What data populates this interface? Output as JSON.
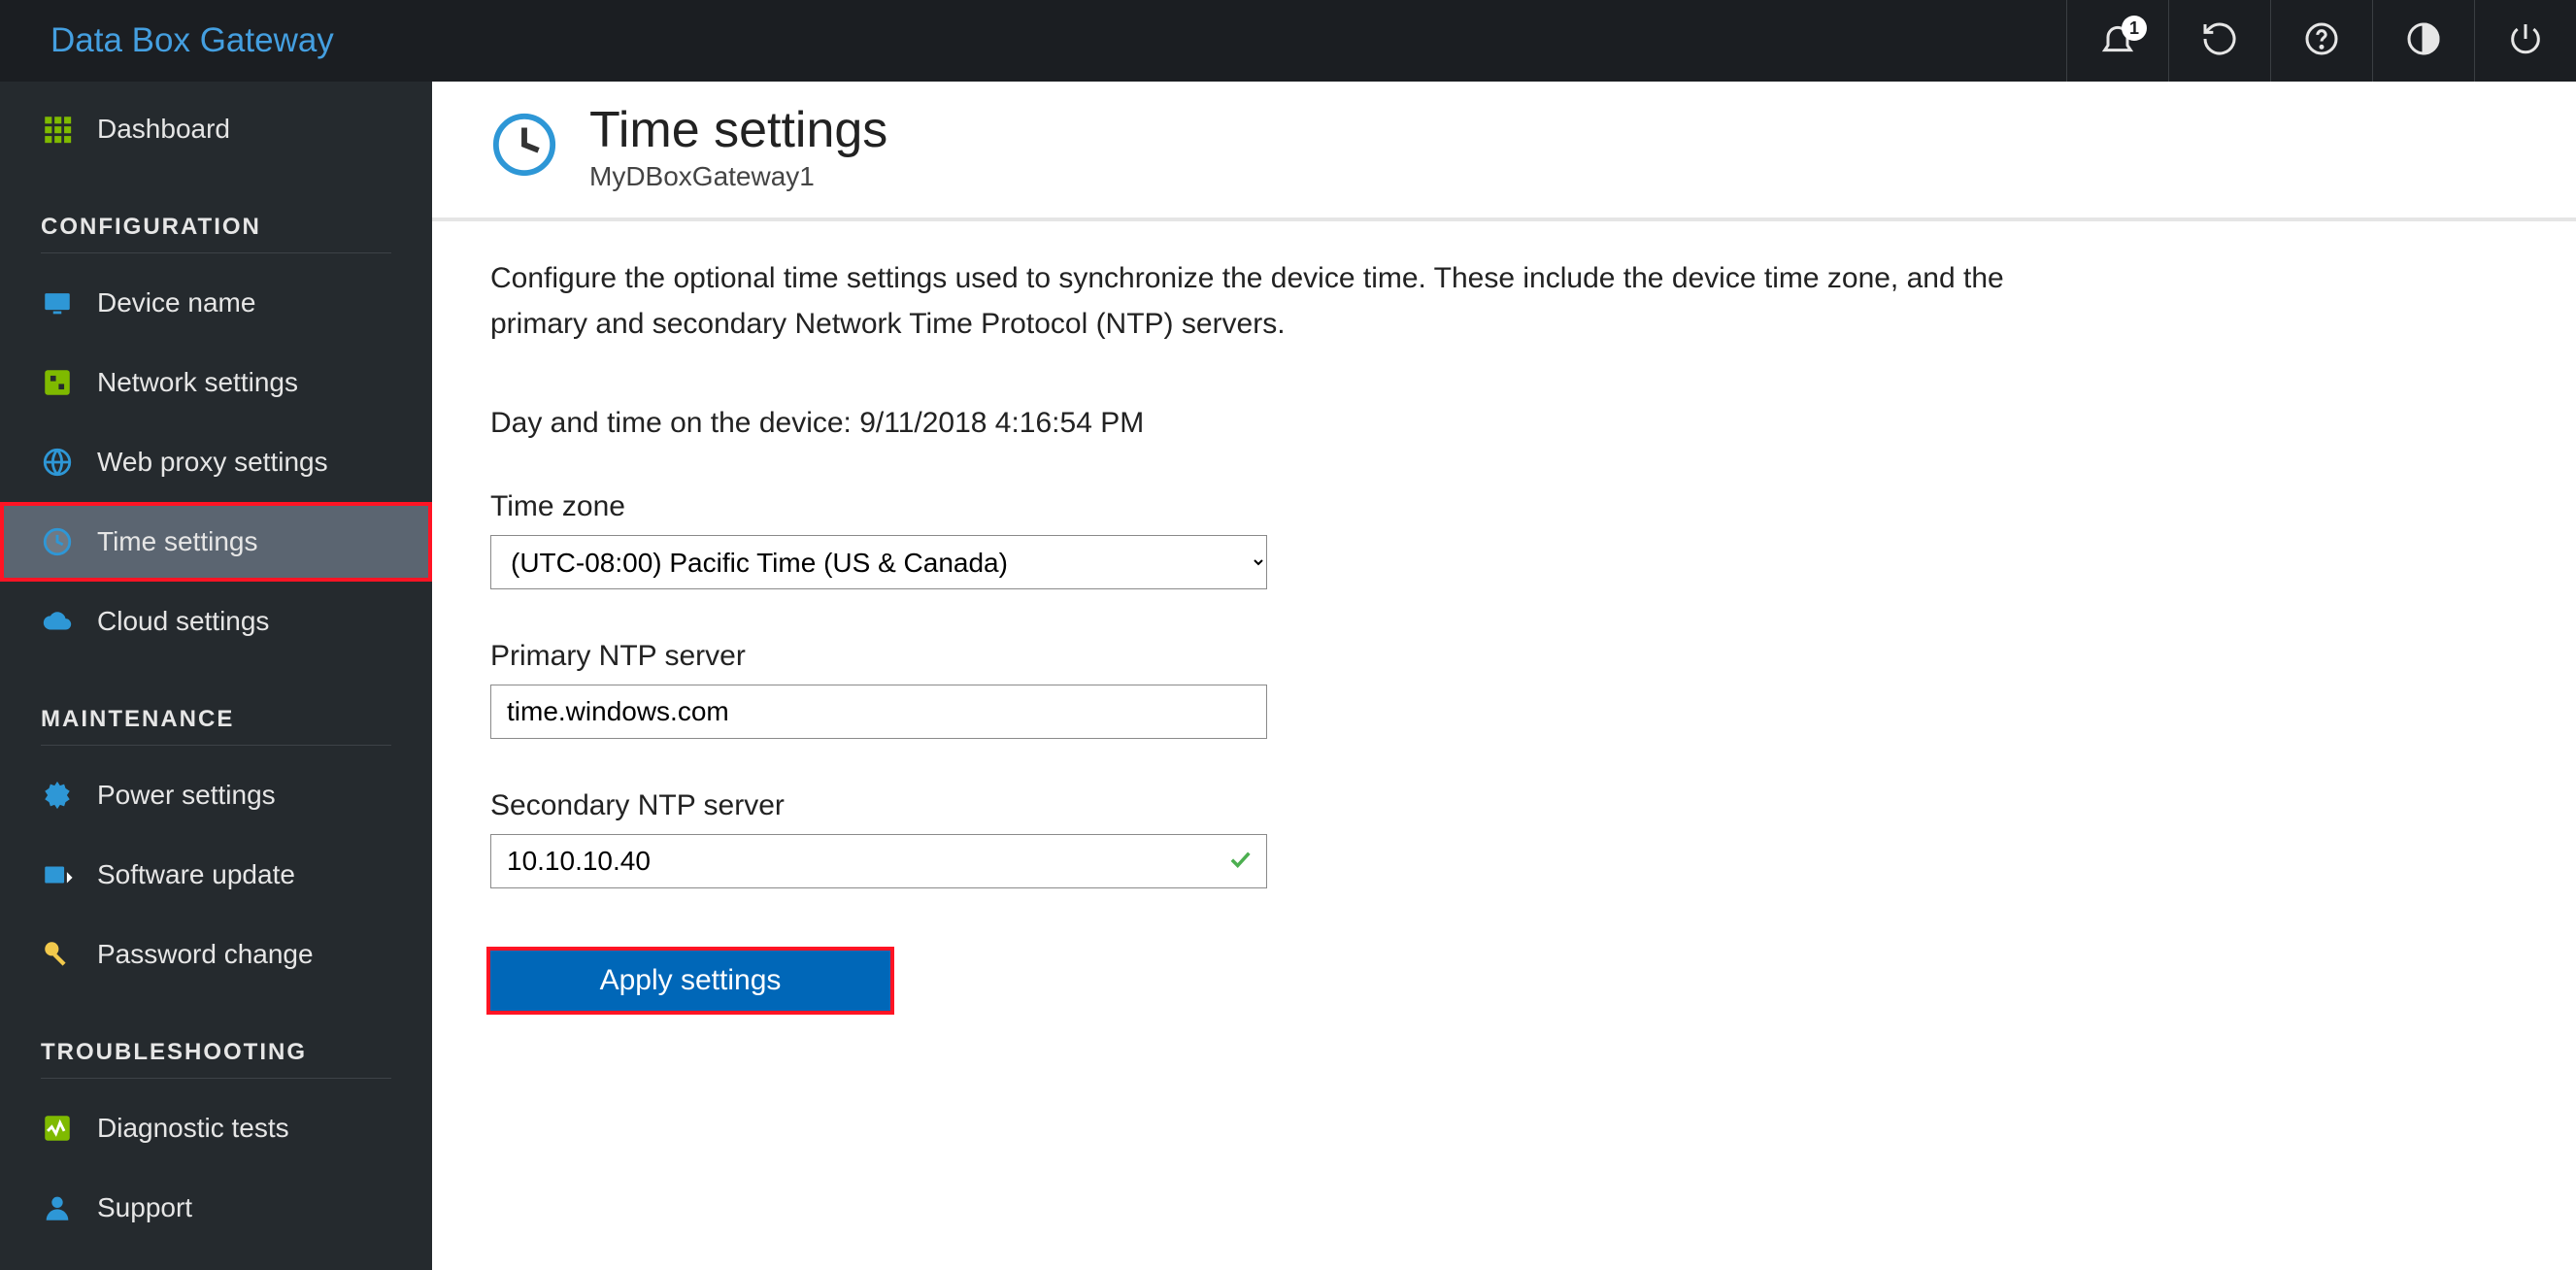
{
  "app": {
    "title": "Data Box Gateway"
  },
  "topbar": {
    "notification_count": "1"
  },
  "sidebar": {
    "dashboard": "Dashboard",
    "sections": {
      "configuration": {
        "heading": "CONFIGURATION",
        "device_name": "Device name",
        "network_settings": "Network settings",
        "web_proxy_settings": "Web proxy settings",
        "time_settings": "Time settings",
        "cloud_settings": "Cloud settings"
      },
      "maintenance": {
        "heading": "MAINTENANCE",
        "power_settings": "Power settings",
        "software_update": "Software update",
        "password_change": "Password change"
      },
      "troubleshooting": {
        "heading": "TROUBLESHOOTING",
        "diagnostic_tests": "Diagnostic tests",
        "support": "Support"
      }
    }
  },
  "page": {
    "title": "Time settings",
    "subtitle": "MyDBoxGateway1",
    "description": "Configure the optional time settings used to synchronize the device time. These include the device time zone, and the primary and secondary Network Time Protocol (NTP) servers.",
    "device_time_label": "Day and time on the device: 9/11/2018 4:16:54 PM",
    "timezone": {
      "label": "Time zone",
      "value": "(UTC-08:00) Pacific Time (US & Canada)"
    },
    "primary_ntp": {
      "label": "Primary NTP server",
      "value": "time.windows.com"
    },
    "secondary_ntp": {
      "label": "Secondary NTP server",
      "value": "10.10.10.40"
    },
    "apply_label": "Apply settings"
  }
}
